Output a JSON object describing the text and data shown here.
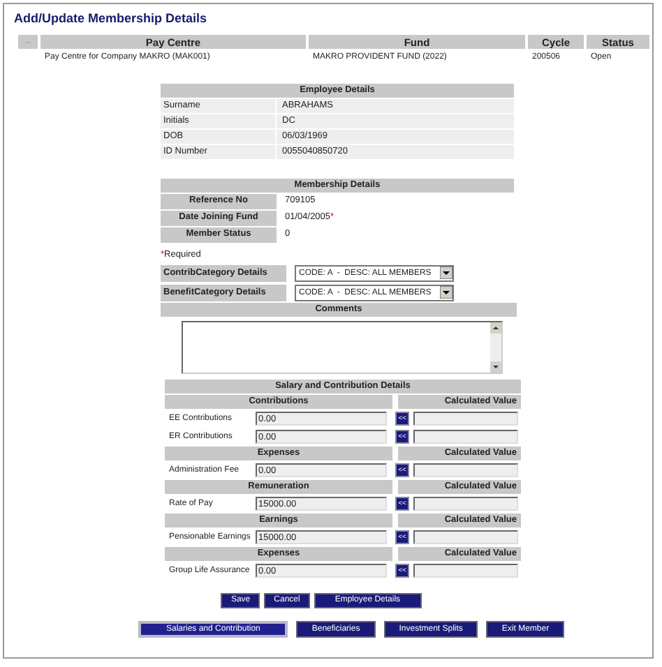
{
  "title": "Add/Update Membership Details",
  "summary": {
    "columns": [
      "...",
      "Pay Centre",
      "Fund",
      "Cycle",
      "Status"
    ],
    "rows": [
      [
        "",
        "Pay Centre for Company MAKRO (MAK001)",
        "MAKRO PROVIDENT FUND (2022)",
        "200506",
        "Open"
      ]
    ]
  },
  "employee_details": {
    "title": "Employee Details",
    "rows": [
      {
        "label": "Surname",
        "value": "ABRAHAMS"
      },
      {
        "label": "Initials",
        "value": "DC"
      },
      {
        "label": "DOB",
        "value": "06/03/1969"
      },
      {
        "label": "ID Number",
        "value": "0055040850720"
      }
    ]
  },
  "membership_details": {
    "title": "Membership Details",
    "rows": [
      {
        "label": "Reference No",
        "value": "709105",
        "mark": ""
      },
      {
        "label": "Date Joining Fund",
        "value": "01/04/2005",
        "mark": "*"
      },
      {
        "label": "Member Status",
        "value": "0",
        "mark": ""
      }
    ]
  },
  "required_note": {
    "mark": "*",
    "text": "Required"
  },
  "categories": [
    {
      "label": "ContribCategory Details",
      "value": "CODE: A  -  DESC: ALL MEMBERS"
    },
    {
      "label": "BenefitCategory Details",
      "value": "CODE: A  -  DESC: ALL MEMBERS"
    }
  ],
  "comments": {
    "title": "Comments"
  },
  "salary": {
    "title": "Salary and Contribution Details",
    "groups": [
      {
        "heading": "Contributions",
        "calc_heading": "Calculated Value",
        "rows": [
          {
            "label": "EE Contributions",
            "value": "0.00",
            "button": "<<"
          },
          {
            "label": "ER Contributions",
            "value": "0.00",
            "button": "<<"
          }
        ]
      },
      {
        "heading": "Expenses",
        "calc_heading": "Calculated Value",
        "rows": [
          {
            "label": "Administration Fee",
            "value": "0.00",
            "button": "<<"
          }
        ]
      },
      {
        "heading": "Remuneration",
        "calc_heading": "Calculated Value",
        "rows": [
          {
            "label": "Rate of Pay",
            "value": "15000.00",
            "button": "<<"
          }
        ]
      },
      {
        "heading": "Earnings",
        "calc_heading": "Calculated Value",
        "rows": [
          {
            "label": "Pensionable Earnings",
            "value": "15000.00",
            "button": "<<"
          }
        ]
      },
      {
        "heading": "Expenses",
        "calc_heading": "Calculated Value",
        "rows": [
          {
            "label": "Group Life Assurance",
            "value": "0.00",
            "button": "<<"
          }
        ]
      }
    ]
  },
  "actions": [
    "Save",
    "Cancel",
    "Employee Details"
  ],
  "tabs": [
    {
      "label": "Salaries and Contribution",
      "selected": true
    },
    {
      "label": "Beneficiaries",
      "selected": false
    },
    {
      "label": "Investment Splits",
      "selected": false
    },
    {
      "label": "Exit Member",
      "selected": false
    }
  ]
}
